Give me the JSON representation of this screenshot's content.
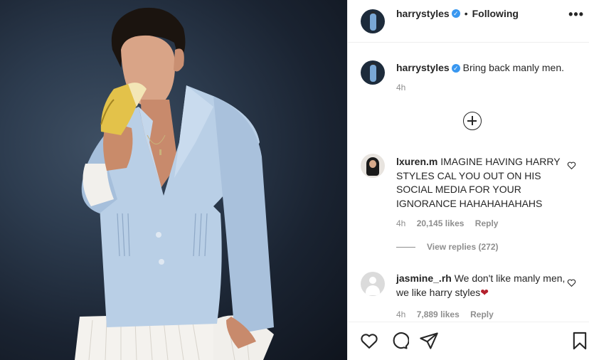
{
  "post": {
    "author": "harrystyles",
    "follow_state": "Following",
    "more_label": "•••",
    "caption_author": "harrystyles",
    "caption_text": "Bring back manly men.",
    "caption_time": "4h"
  },
  "comments": [
    {
      "user": "lxuren.m",
      "text": "IMAGINE HAVING HARRY STYLES CAL YOU OUT ON HIS SOCIAL MEDIA FOR YOUR IGNORANCE HAHAHAHAHAHS",
      "time": "4h",
      "likes": "20,145 likes",
      "reply": "Reply",
      "view_replies": "View replies (272)"
    },
    {
      "user": "jasmine_.rh",
      "text": "We don't like manly men, we like harry styles",
      "emoji": "❤",
      "time": "4h",
      "likes": "7,889 likes",
      "reply": "Reply"
    }
  ],
  "colors": {
    "accent": "#3897f0",
    "text": "#262626",
    "muted": "#8e8e8e",
    "heart": "#b3202d",
    "jacket": "#b9cfe6"
  },
  "icons": [
    "verified-badge-icon",
    "more-options-icon",
    "add-comment-icon",
    "like-comment-icon",
    "like-icon",
    "comment-icon",
    "share-icon",
    "save-icon"
  ]
}
